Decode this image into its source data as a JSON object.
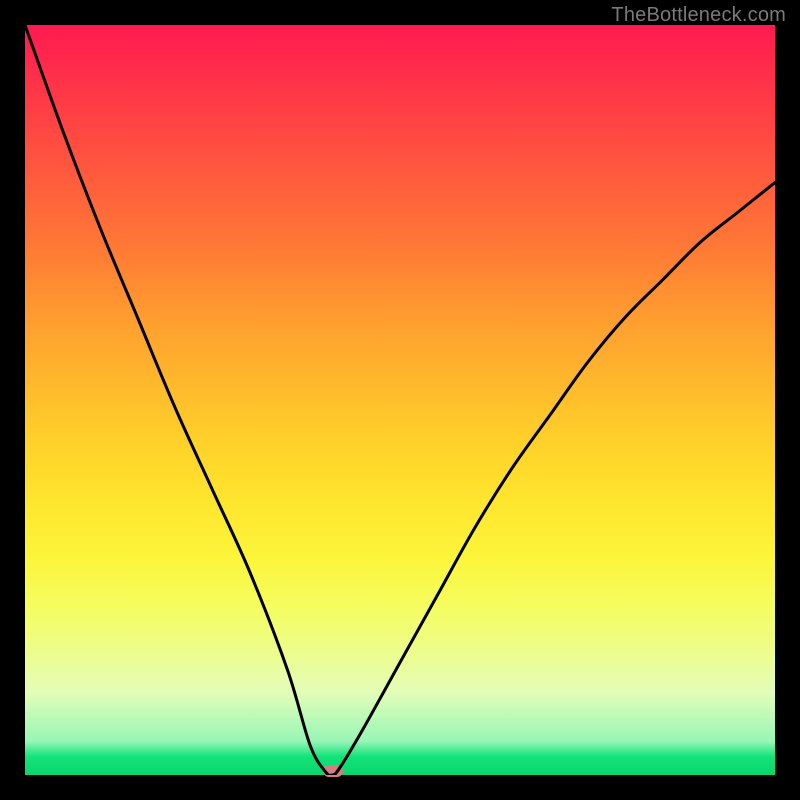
{
  "watermark": "TheBottleneck.com",
  "colors": {
    "background": "#000000",
    "gradient_top": "#ff1a50",
    "gradient_bottom": "#0ad56c",
    "curve": "#000000",
    "marker": "#d67d7f",
    "watermark_text": "#7a7a7a"
  },
  "chart_data": {
    "type": "line",
    "title": "",
    "xlabel": "",
    "ylabel": "",
    "xlim": [
      0,
      100
    ],
    "ylim": [
      0,
      100
    ],
    "grid": false,
    "legend": false,
    "series": [
      {
        "name": "bottleneck-curve",
        "x": [
          0,
          5,
          10,
          15,
          20,
          25,
          30,
          35,
          38,
          40,
          41,
          42,
          45,
          50,
          55,
          60,
          65,
          70,
          75,
          80,
          85,
          90,
          95,
          100
        ],
        "y": [
          100,
          86,
          73,
          61,
          49,
          38,
          27,
          14,
          4,
          0.5,
          0,
          1,
          6,
          15,
          24,
          33,
          41,
          48,
          55,
          61,
          66,
          71,
          75,
          79
        ]
      }
    ],
    "marker": {
      "x": 41,
      "y": 0
    },
    "notes": "Background is a vertical red→yellow→green gradient; curve is a V-shaped bottleneck with minimum near x≈41. A small rounded marker sits at the trough. No axis ticks or labels are shown."
  }
}
